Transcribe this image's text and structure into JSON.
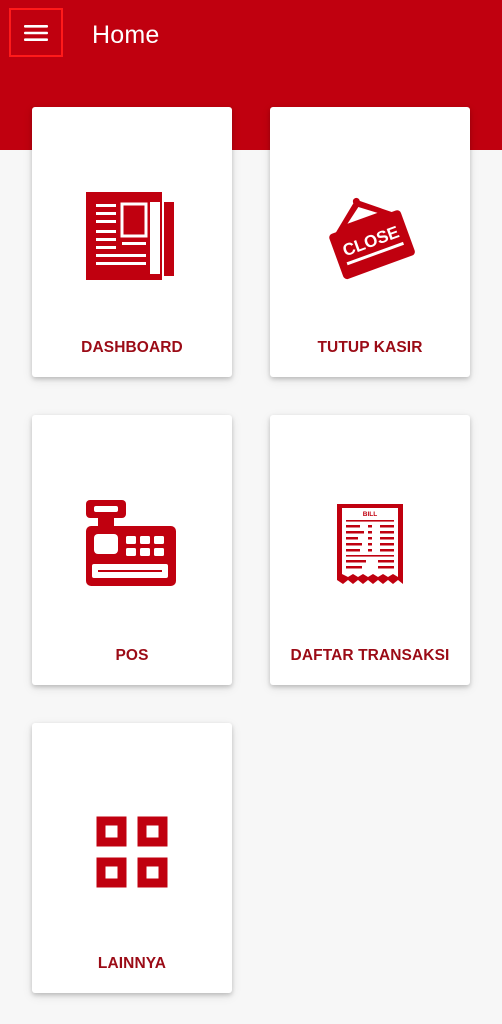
{
  "app_bar": {
    "title": "Home",
    "menu_icon": "hamburger-menu-icon",
    "background_color": "#c0000f"
  },
  "accent_color": "#c0000f",
  "menu_tiles": [
    {
      "label": "DASHBOARD",
      "icon": "newspaper-icon"
    },
    {
      "label": "TUTUP KASIR",
      "icon": "close-sign-icon",
      "icon_text": "CLOSE"
    },
    {
      "label": "POS",
      "icon": "cash-register-icon"
    },
    {
      "label": "DAFTAR TRANSAKSI",
      "icon": "bill-receipt-icon",
      "icon_text": "BILL"
    },
    {
      "label": "LAINNYA",
      "icon": "grid-four-squares-icon"
    }
  ]
}
